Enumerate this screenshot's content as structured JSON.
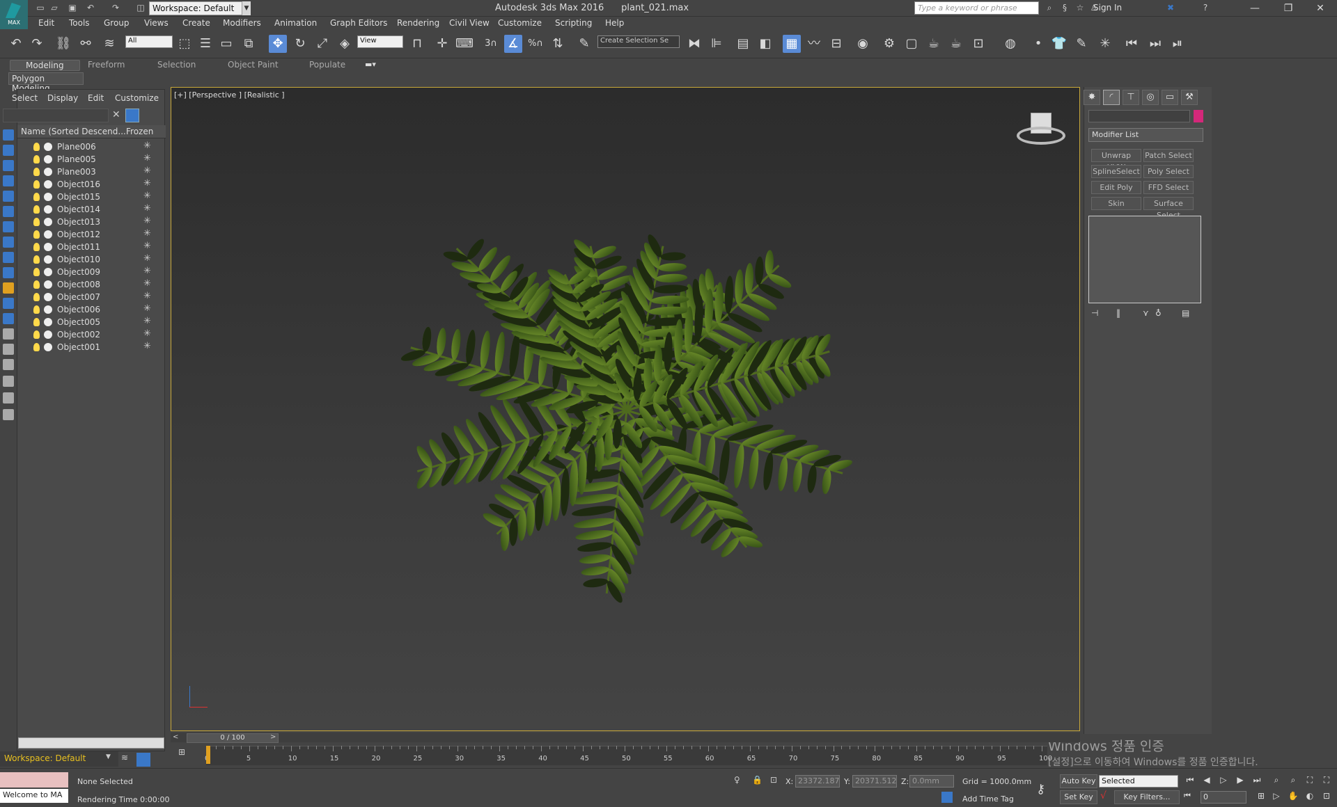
{
  "app": {
    "logo_text": "MAX",
    "workspace": "Workspace: Default",
    "title": "Autodesk 3ds Max 2016",
    "file": "plant_021.max",
    "search_placeholder": "Type a keyword or phrase",
    "sign_in": "Sign In"
  },
  "menus": [
    "Edit",
    "Tools",
    "Group",
    "Views",
    "Create",
    "Modifiers",
    "Animation",
    "Graph Editors",
    "Rendering",
    "Civil View",
    "Customize",
    "Scripting",
    "Help"
  ],
  "toolbar": {
    "filter": "All",
    "ref_coord": "View",
    "selection_set": "Create Selection Se",
    "snap_num": "3",
    "percent": "%"
  },
  "ribbon": {
    "tabs": [
      "Modeling",
      "Freeform",
      "Selection",
      "Object Paint",
      "Populate"
    ],
    "sub": "Polygon Modeling"
  },
  "scene_explorer": {
    "menus": [
      "Select",
      "Display",
      "Edit",
      "Customize"
    ],
    "col_name": "Name (Sorted Descend...",
    "col_frozen": "Frozen",
    "objects": [
      "Plane006",
      "Plane005",
      "Plane003",
      "Object016",
      "Object015",
      "Object014",
      "Object013",
      "Object012",
      "Object011",
      "Object010",
      "Object009",
      "Object008",
      "Object007",
      "Object006",
      "Object005",
      "Object002",
      "Object001"
    ],
    "workspace": "Workspace: Default"
  },
  "viewport": {
    "label": "[+] [Perspective ] [Realistic ]",
    "watermark_title": "Windows 정품 인증",
    "watermark_sub": "[설정]으로 이동하여 Windows를 정품 인증합니다."
  },
  "command_panel": {
    "modifier_list": "Modifier List",
    "buttons": [
      "Unwrap UVW",
      "Patch Select",
      "SplineSelect",
      "Poly Select",
      "Edit Poly",
      "FFD Select",
      "Skin",
      "Surface Select"
    ]
  },
  "timeline": {
    "frame": "0 / 100",
    "ticks": [
      "0",
      "5",
      "10",
      "15",
      "20",
      "25",
      "30",
      "35",
      "40",
      "45",
      "50",
      "55",
      "60",
      "65",
      "70",
      "75",
      "80",
      "85",
      "90",
      "95",
      "100"
    ]
  },
  "status": {
    "maxscript": "Welcome to MA",
    "selection": "None Selected",
    "render_time": "Rendering Time  0:00:00",
    "x_label": "X:",
    "x": "23372.187",
    "y_label": "Y:",
    "y": "20371.512",
    "z_label": "Z:",
    "z": "0.0mm",
    "grid": "Grid = 1000.0mm",
    "add_time_tag": "Add Time Tag",
    "auto_key": "Auto Key",
    "set_key": "Set Key",
    "key_mode": "Selected",
    "key_filters": "Key Filters...",
    "current_frame": "0"
  },
  "colors": {
    "accent_blue": "#5a8bd6",
    "viewport_border": "#c9a93a",
    "color_swatch": "#d4287a",
    "workspace_text": "#e8c020"
  }
}
